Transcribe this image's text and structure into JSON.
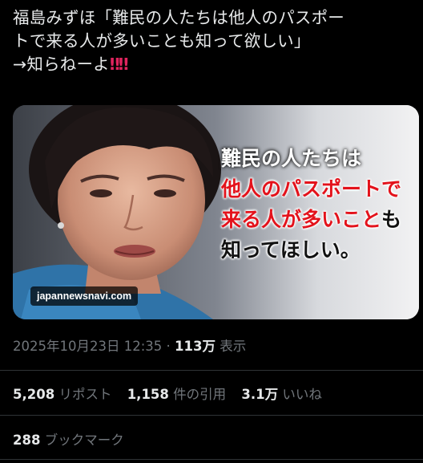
{
  "tweet": {
    "line1": "福島みずほ「難民の人たちは他人のパスポー",
    "line2": "トで来る人が多いことも知って欲しい」",
    "line3": "→知らねーよ",
    "emphasis": "‼‼"
  },
  "media": {
    "caption": {
      "line1": "難民の人たちは",
      "line2_red": "他人のパスポートで",
      "line3_red": "来る人が多いこと",
      "line3_dark": "も",
      "line4": "知ってほしい。"
    },
    "watermark": "japannewsnavi.com"
  },
  "meta": {
    "datetime": "2025年10月23日 12:35",
    "separator": "·",
    "views_count": "113万",
    "views_label": "表示"
  },
  "stats": {
    "reposts_count": "5,208",
    "reposts_label": "リポスト",
    "quotes_count": "1,158",
    "quotes_label": "件の引用",
    "likes_count": "3.1万",
    "likes_label": "いいね"
  },
  "bookmarks": {
    "count": "288",
    "label": "ブックマーク"
  },
  "colors": {
    "background": "#000000",
    "text": "#e7e9ea",
    "muted": "#71767b",
    "emphasis_red": "#e0245e",
    "caption_red": "#e3121b"
  }
}
